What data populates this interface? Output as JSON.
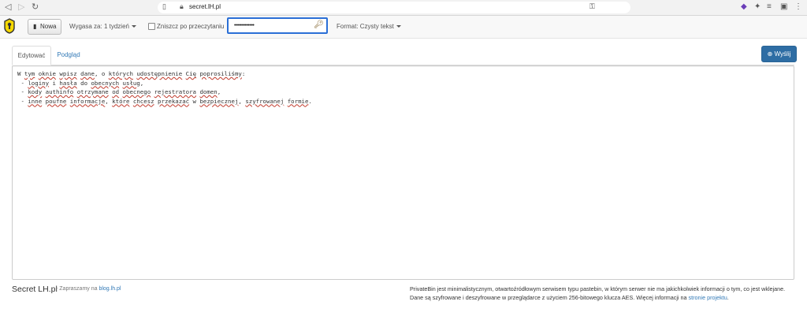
{
  "browser": {
    "url": "secret.lH.pl"
  },
  "toolbar": {
    "new_label": "Nowa",
    "expire_label": "Wygasa za: 1 tydzień",
    "burn_label": "Zniszcz po przeczytaniu",
    "password_value": "•••••••••••••",
    "format_label": "Format: Czysty tekst"
  },
  "tabs": {
    "edit": "Edytować",
    "preview": "Podgląd"
  },
  "send_label": "Wyślij",
  "editor": {
    "lines": [
      "W tym oknie wpisz dane, o których udostępnienie Cię poprosiliśmy:",
      " - loginy i hasła do obecnych usług,",
      " - kody authinfo otrzymane od obecnego rejestratora domen,",
      " - inne poufne informacje, które chcesz przekazać w bezpiecznej, szyfrowanej formie."
    ]
  },
  "footer": {
    "brand": "Secret LH.pl",
    "sub_prefix": "- Zapraszamy na ",
    "sub_link": "blog.lh.pl",
    "info_text": "PrivateBin jest minimalistycznym, otwartoźródłowym serwisem typu pastebin, w którym serwer nie ma jakichkolwiek informacji o tym, co jest wklejane. Dane są szyfrowane i deszyfrowane w przeglądarce z użyciem 256-bitowego klucza AES. Więcej informacji na ",
    "info_link": "stronie projektu",
    "info_end": "."
  }
}
